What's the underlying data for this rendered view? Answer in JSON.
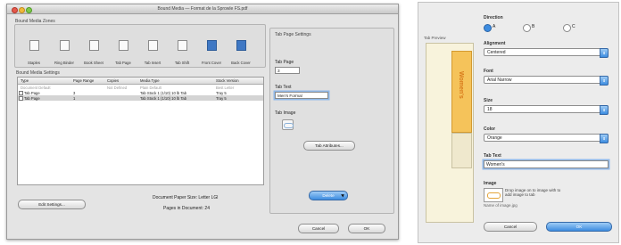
{
  "dialog": {
    "title": "Bound Media — Format de la Sprowle FS.pdf",
    "media_group_label": "Bound Media Zones",
    "media_tools": [
      {
        "label": "Staples",
        "icon": "staples-icon"
      },
      {
        "label": "Ring Binder",
        "icon": "ring-binder-icon"
      },
      {
        "label": "Book Sheet",
        "icon": "book-sheet-icon"
      },
      {
        "label": "Tab Page",
        "icon": "tab-page-icon"
      },
      {
        "label": "Tab Insert",
        "icon": "tab-insert-icon"
      },
      {
        "label": "Tab Shift",
        "icon": "tab-shift-icon"
      },
      {
        "label": "Front Cover",
        "icon": "front-cover-icon"
      },
      {
        "label": "Back Cover",
        "icon": "back-cover-icon"
      }
    ],
    "settings_group_label": "Bound Media Settings",
    "table": {
      "columns": [
        "Type",
        "Page Range",
        "Copies",
        "Media Type",
        "Stock Version"
      ],
      "rows": [
        [
          "Document Default",
          "",
          "Not Defined",
          "Plain Default",
          "Best Letter"
        ],
        [
          "Tab Page",
          "3",
          "",
          "Tab Stock 1 (1/10) 10 lb Tab",
          "Tray 5"
        ],
        [
          "Tab Page",
          "1",
          "",
          "Tab Stock 1 (1/10) 10 lb Tab",
          "Tray 5"
        ]
      ]
    },
    "tab_settings": {
      "group_label": "Tab Page Settings",
      "tab_page_label": "Tab Page",
      "tab_page_value": "3",
      "tab_text_label": "Tab Text",
      "tab_text_value": "Men's Formal",
      "tab_image_label": "Tab Image",
      "tab_attributes_button": "Tab Attributes...",
      "delete_button": "Delete"
    },
    "edit_settings_button": "Edit Settings...",
    "document_paper_size": "Document Paper Size:  Letter LGl",
    "pages_in_document": "Pages in Document:  24",
    "cancel_button": "Cancel",
    "ok_button": "OK"
  },
  "panel": {
    "direction_label": "Direction",
    "direction_options": [
      "A",
      "B",
      "C"
    ],
    "preview_label": "Tab Preview",
    "preview_tab_text": "Women's",
    "alignment_label": "Alignment",
    "alignment_value": "Centered",
    "font_label": "Font",
    "font_value": "Arial Narrow",
    "size_label": "Size",
    "size_value": "18",
    "color_label": "Color",
    "color_value": "Orange",
    "tab_text_label": "Tab Text",
    "tab_text_value": "Women's",
    "image_label": "Image",
    "image_hint": "Drop image on to image with to add image to tab",
    "image_filename": "Name of image.jpg",
    "cancel_button": "Cancel",
    "ok_button": "OK",
    "accent_color": "#3d8ce0",
    "tab_color": "#f5c35a"
  }
}
